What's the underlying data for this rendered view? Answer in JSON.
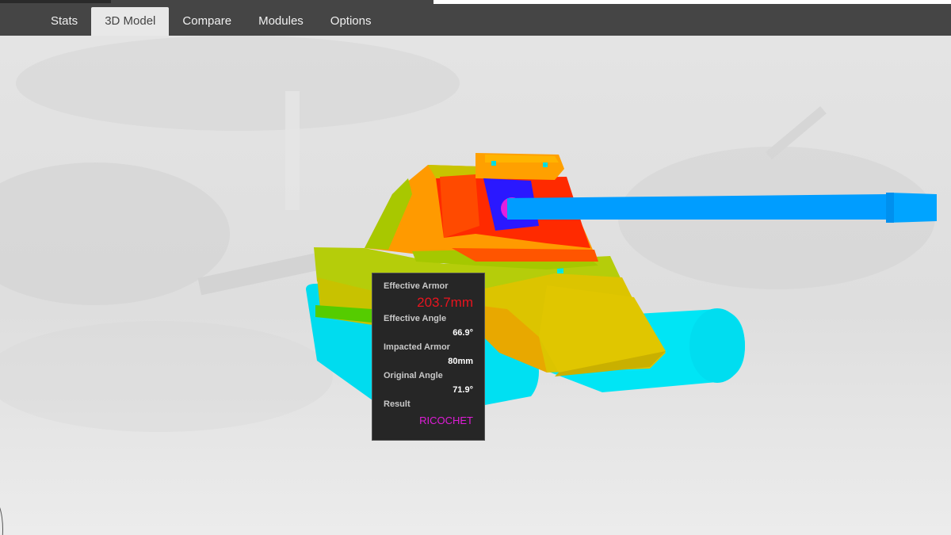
{
  "nav": {
    "tabs": [
      {
        "label": "Stats",
        "active": false
      },
      {
        "label": "3D Model",
        "active": true
      },
      {
        "label": "Compare",
        "active": false
      },
      {
        "label": "Modules",
        "active": false
      },
      {
        "label": "Options",
        "active": false
      }
    ]
  },
  "tooltip": {
    "effective_armor_label": "Effective Armor",
    "effective_armor_value": "203.7mm",
    "effective_angle_label": "Effective Angle",
    "effective_angle_value": "66.9°",
    "impacted_armor_label": "Impacted Armor",
    "impacted_armor_value": "80mm",
    "original_angle_label": "Original Angle",
    "original_angle_value": "71.9°",
    "result_label": "Result",
    "result_value": "RICOCHET"
  },
  "colors": {
    "nav_bg": "#454545",
    "armor_high": "#ff2a00",
    "armor_mid": "#ff8c00",
    "armor_low": "#c8c800",
    "tracks_and_gun": "#00e5ff",
    "gun_barrel": "#009dff",
    "impact_zone": "#2a18ff",
    "impact_marker": "#e020e0",
    "ricochet_text": "#e01cd8",
    "effective_armor_text": "#e8141e"
  }
}
